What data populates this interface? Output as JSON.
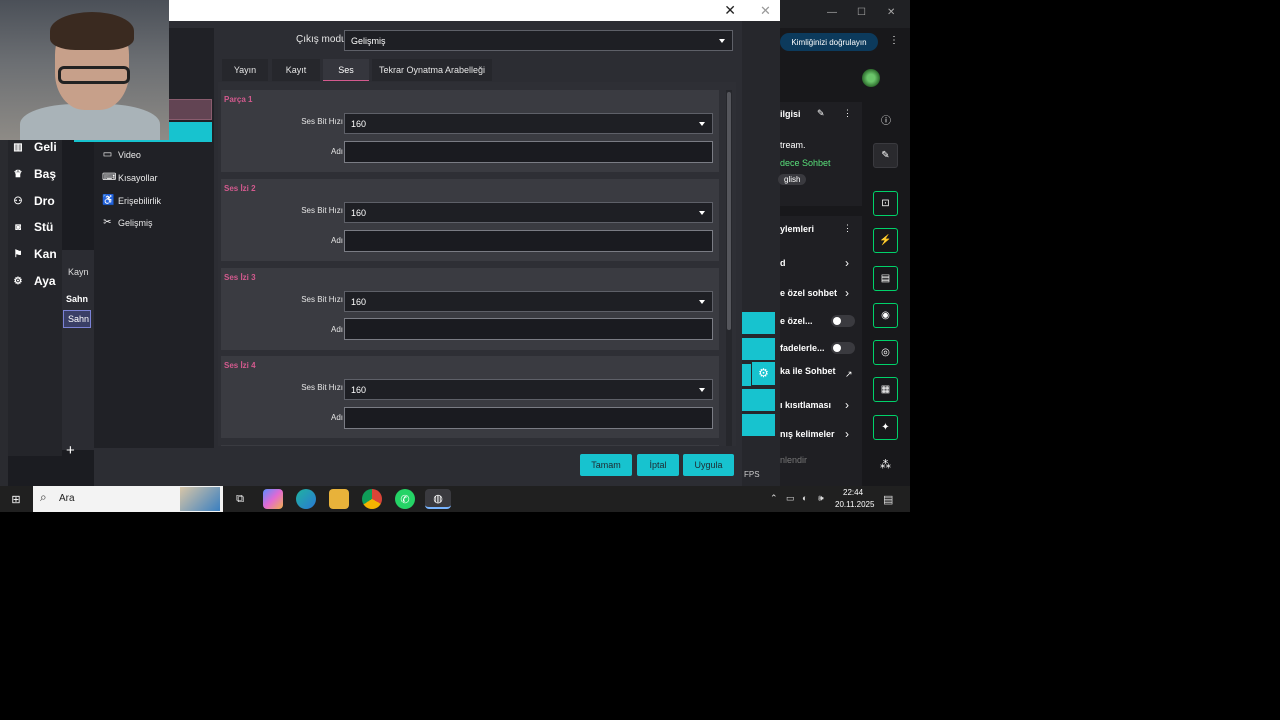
{
  "main_nav": [
    {
      "label": "Geli",
      "icon": "chart-icon"
    },
    {
      "label": "Baş",
      "icon": "trophy-icon"
    },
    {
      "label": "Dro",
      "icon": "people-icon"
    },
    {
      "label": "Stü",
      "icon": "studio-icon"
    },
    {
      "label": "Kan",
      "icon": "channel-icon"
    },
    {
      "label": "Aya",
      "icon": "gear-icon"
    }
  ],
  "dock": {
    "sources_label": "Kayn",
    "scenes_label": "Sahn",
    "scene_item": "Sahn",
    "add_label": "+"
  },
  "settings": {
    "categories": [
      {
        "label": "Video",
        "icon": "monitor-icon"
      },
      {
        "label": "Kısayollar",
        "icon": "keyboard-icon"
      },
      {
        "label": "Erişebilirlik",
        "icon": "accessibility-icon"
      },
      {
        "label": "Gelişmiş",
        "icon": "tools-icon"
      }
    ],
    "output_mode_label": "Çıkış modu",
    "output_mode_value": "Gelişmiş",
    "tabs": [
      "Yayın",
      "Kayıt",
      "Ses",
      "Tekrar Oynatma Arabelleği"
    ],
    "active_tab": "Ses",
    "tracks": [
      {
        "title": "Parça 1",
        "bitrate_label": "Ses Bit Hızı",
        "bitrate": "160",
        "name_label": "Adı",
        "name": ""
      },
      {
        "title": "Ses İzi 2",
        "bitrate_label": "Ses Bit Hızı",
        "bitrate": "160",
        "name_label": "Adı",
        "name": ""
      },
      {
        "title": "Ses İzi 3",
        "bitrate_label": "Ses Bit Hızı",
        "bitrate": "160",
        "name_label": "Adı",
        "name": ""
      },
      {
        "title": "Ses İzi 4",
        "bitrate_label": "Ses Bit Hızı",
        "bitrate": "160",
        "name_label": "Adı",
        "name": ""
      }
    ],
    "buttons": {
      "ok": "Tamam",
      "cancel": "İptal",
      "apply": "Uygula"
    },
    "close_glyph": "✕"
  },
  "bg_window": {
    "close_glyph": "✕",
    "fps_label": "FPS"
  },
  "right_panel": {
    "verify_label": "Kimliğinizi doğrulayın",
    "stream_info_header": "ilgisi",
    "stream_text": "tream.",
    "chat_mode": "dece Sohbet",
    "language_tag": "glish",
    "actions_header": "ylemleri",
    "rows": [
      {
        "label": "d"
      },
      {
        "label": "e özel sohbet"
      },
      {
        "label": "e özel..."
      },
      {
        "label": "fadelerle..."
      },
      {
        "label": "ka ile Sohbet"
      },
      {
        "label": "ı kısıtlaması"
      },
      {
        "label": "nış kelimeler"
      },
      {
        "label": "nlendir"
      }
    ]
  },
  "taskbar": {
    "search_placeholder": "Ara",
    "time": "22:44",
    "date": "20.11.2025"
  },
  "colors": {
    "accent": "#17c3cf",
    "track_title": "#d35a8e",
    "mod_green": "#00d26a"
  }
}
